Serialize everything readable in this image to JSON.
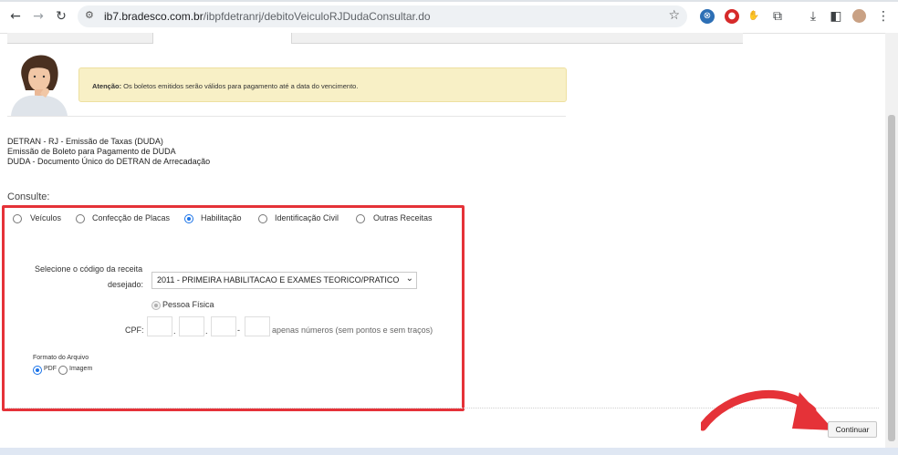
{
  "browser": {
    "url_host": "ib7.bradesco.com.br",
    "url_path": "/ibpfdetranrj/debitoVeiculoRJDudaConsultar.do",
    "icons": [
      "back-icon",
      "forward-icon",
      "reload-icon",
      "site-settings-icon",
      "bookmark-star-icon",
      "extension-icon",
      "download-icon",
      "side-panel-icon",
      "profile-avatar",
      "menu-icon"
    ]
  },
  "notice": {
    "label": "Atenção:",
    "text": " Os boletos emitidos serão válidos para pagamento até a data do vencimento."
  },
  "intro": {
    "line1": "DETRAN - RJ - Emissão de Taxas (DUDA)",
    "line2": "Emissão de Boleto para Pagamento de DUDA",
    "line3": "DUDA - Documento Único do DETRAN de Arrecadação"
  },
  "form": {
    "heading": "Consulte:",
    "types": [
      {
        "label": "Veículos",
        "selected": false
      },
      {
        "label": "Confecção de Placas",
        "selected": false
      },
      {
        "label": "Habilitação",
        "selected": true
      },
      {
        "label": "Identificação Civil",
        "selected": false
      },
      {
        "label": "Outras Receitas",
        "selected": false
      }
    ],
    "receita_label_1": "Selecione o código da receita",
    "receita_label_2": "desejado:",
    "receita_value": "2011  -  PRIMEIRA HABILITACAO E EXAMES TEORICO/PRATICO",
    "pessoa_label": "Pessoa Física",
    "cpf_label": "CPF:",
    "cpf_sep_1": ".",
    "cpf_sep_2": ".",
    "cpf_sep_3": "-",
    "cpf_hint": "apenas números (sem pontos e sem traços)",
    "format_label": "Formato do Arquivo",
    "format_pdf": "PDF",
    "format_image": "Imagem",
    "format_selected": "PDF"
  },
  "continue_label": "Continuar",
  "colors": {
    "highlight_box": "#e53238",
    "notice_bg": "#f8f0c6",
    "radio_selected": "#1a73e8"
  }
}
